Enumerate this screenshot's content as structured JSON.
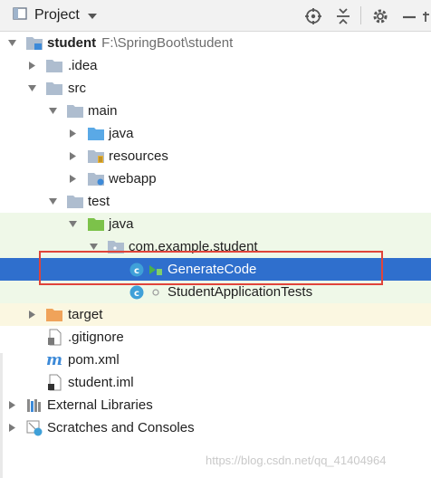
{
  "toolbar": {
    "title": "Project",
    "icons": [
      "project-window-icon",
      "chevron-down-icon",
      "locate-icon",
      "collapse-all-icon",
      "gear-icon",
      "hide-icon"
    ]
  },
  "tree": {
    "root_name": "student",
    "root_path": "F:\\SpringBoot\\student",
    "items": [
      {
        "label": "student"
      },
      {
        "label": ".idea"
      },
      {
        "label": "src"
      },
      {
        "label": "main"
      },
      {
        "label": "java"
      },
      {
        "label": "resources"
      },
      {
        "label": "webapp"
      },
      {
        "label": "test"
      },
      {
        "label": "java"
      },
      {
        "label": "com.example.student"
      },
      {
        "label": "GenerateCode"
      },
      {
        "label": "StudentApplicationTests"
      },
      {
        "label": "target"
      },
      {
        "label": ".gitignore"
      },
      {
        "label": "pom.xml"
      },
      {
        "label": "student.iml"
      },
      {
        "label": "External Libraries"
      },
      {
        "label": "Scratches and Consoles"
      }
    ]
  },
  "watermark": "https://blog.csdn.net/qq_41404964",
  "colors": {
    "selection": "#2f6fcd",
    "test_folder_bg": "#eff8e8",
    "excluded_bg": "#fbf7e1",
    "highlight_border": "#e0443a"
  }
}
